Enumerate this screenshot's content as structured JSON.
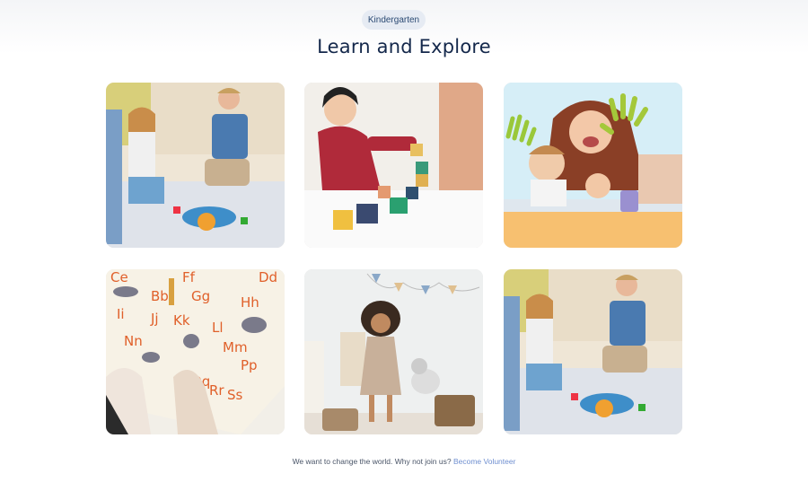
{
  "badge": "Kindergarten",
  "title": "Learn and Explore",
  "gallery": [
    {
      "alt": "Children playing with toy blocks on the floor"
    },
    {
      "alt": "Girl stacking colorful wooden blocks"
    },
    {
      "alt": "Mother and children with painted hands"
    },
    {
      "alt": "Alphabet poster with animals"
    },
    {
      "alt": "Girl dancing in playroom"
    },
    {
      "alt": "Children playing with toy blocks on the floor"
    }
  ],
  "footer": {
    "text": "We want to change the world. Why not join us?",
    "link": "Become Volunteer"
  },
  "colors": {
    "title": "#14284b",
    "link": "#6f8fd0",
    "badge_bg": "#e6ebf3"
  }
}
